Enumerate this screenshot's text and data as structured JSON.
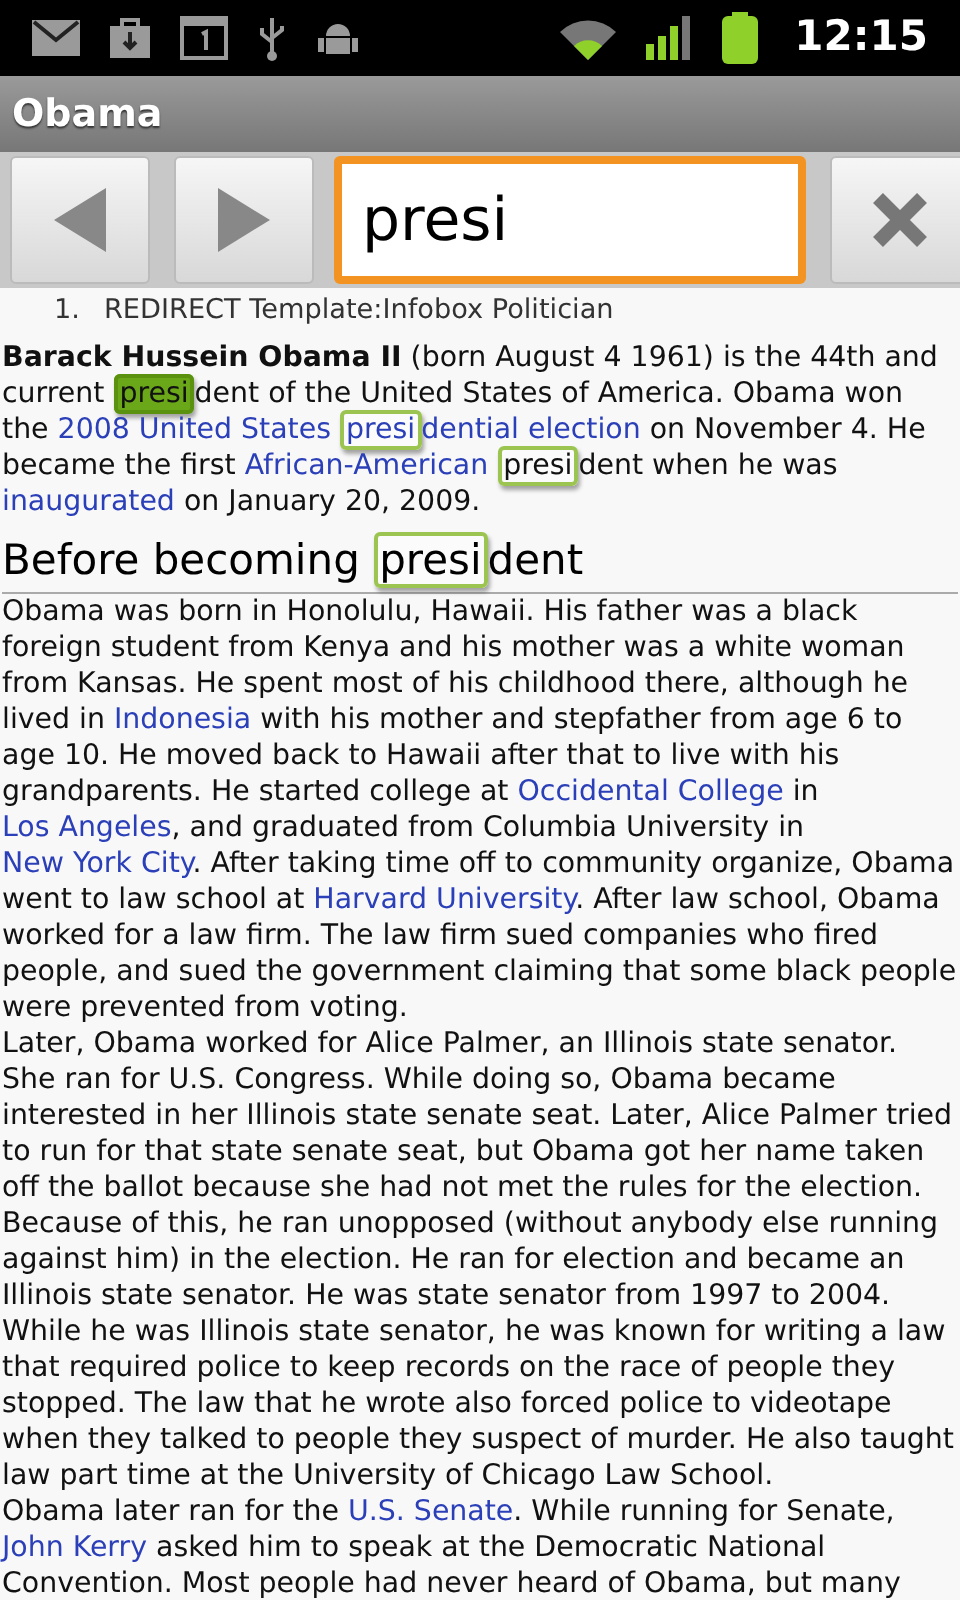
{
  "status_bar": {
    "time": "12:15"
  },
  "window": {
    "title": "Obama"
  },
  "find_bar": {
    "value": "presi"
  },
  "list_item": {
    "number": "1.",
    "text": "REDIRECT Template:Infobox Politician"
  },
  "article": [
    {
      "kind": "paragraph",
      "segments": [
        {
          "kind": "bold",
          "text": "Barack Hussein Obama II"
        },
        {
          "kind": "text",
          "text": " (born August 4 1961) is the 44th and current "
        },
        {
          "kind": "match",
          "text": "presi",
          "selected": true,
          "in_link": false
        },
        {
          "kind": "text",
          "text": "dent of the United States of America. Obama won the "
        },
        {
          "kind": "link",
          "text": "2008 United States "
        },
        {
          "kind": "match",
          "text": "presi",
          "selected": false,
          "in_link": true
        },
        {
          "kind": "link",
          "text": "dential election"
        },
        {
          "kind": "text",
          "text": " on November 4. He became the first "
        },
        {
          "kind": "link",
          "text": "African-American "
        },
        {
          "kind": "match",
          "text": "presi",
          "selected": false,
          "in_link": false
        },
        {
          "kind": "text",
          "text": "dent when he was "
        },
        {
          "kind": "link",
          "text": "inaugurated"
        },
        {
          "kind": "text",
          "text": " on January 20, 2009."
        }
      ]
    },
    {
      "kind": "heading",
      "segments": [
        {
          "kind": "text",
          "text": "Before becoming "
        },
        {
          "kind": "match",
          "text": "presi",
          "selected": false,
          "in_link": false
        },
        {
          "kind": "text",
          "text": "dent"
        }
      ]
    },
    {
      "kind": "paragraph",
      "segments": [
        {
          "kind": "text",
          "text": "Obama was born in Honolulu, Hawaii. His father was a black foreign student from Kenya and his mother was a white woman from Kansas. He spent most of his childhood there, although he lived in "
        },
        {
          "kind": "link",
          "text": "Indonesia"
        },
        {
          "kind": "text",
          "text": " with his mother and stepfather from age 6 to age 10. He moved back to Hawaii after that to live with his grandparents. He started college at "
        },
        {
          "kind": "link",
          "text": "Occidental College"
        },
        {
          "kind": "text",
          "text": " in "
        },
        {
          "kind": "link",
          "text": "Los Angeles"
        },
        {
          "kind": "text",
          "text": ", and graduated from Columbia University in "
        },
        {
          "kind": "link",
          "text": "New York City"
        },
        {
          "kind": "text",
          "text": ". After taking time off to community organize, Obama went to law school at "
        },
        {
          "kind": "link",
          "text": "Harvard University"
        },
        {
          "kind": "text",
          "text": ". After law school, Obama worked for a law firm. The law firm sued companies who fired people, and sued the government claiming that some black people were prevented from voting."
        }
      ]
    },
    {
      "kind": "paragraph",
      "segments": [
        {
          "kind": "text",
          "text": "Later, Obama worked for Alice Palmer, an Illinois state senator. She ran for U.S. Congress. While doing so, Obama became interested in her Illinois state senate seat. Later, Alice Palmer tried to run for that state senate seat, but Obama got her name taken off the ballot because she had not met the rules for the election. Because of this, he ran unopposed (without anybody else running against him) in the election. He ran for election and became an Illinois state senator. He was state senator from 1997 to 2004."
        }
      ]
    },
    {
      "kind": "paragraph",
      "segments": [
        {
          "kind": "text",
          "text": "While he was Illinois state senator, he was known for writing a law that required police to keep records on the race of people they stopped. The law that he wrote also forced police to videotape when they talked to people they suspect of murder. He also taught law part time at the University of Chicago Law School."
        }
      ]
    },
    {
      "kind": "paragraph",
      "segments": [
        {
          "kind": "text",
          "text": "Obama later ran for the "
        },
        {
          "kind": "link",
          "text": "U.S. Senate"
        },
        {
          "kind": "text",
          "text": ". While running for Senate, "
        },
        {
          "kind": "link",
          "text": "John Kerry"
        },
        {
          "kind": "text",
          "text": " asked him to speak at the Democratic National Convention. Most people had never heard of Obama, but many"
        }
      ]
    }
  ]
}
